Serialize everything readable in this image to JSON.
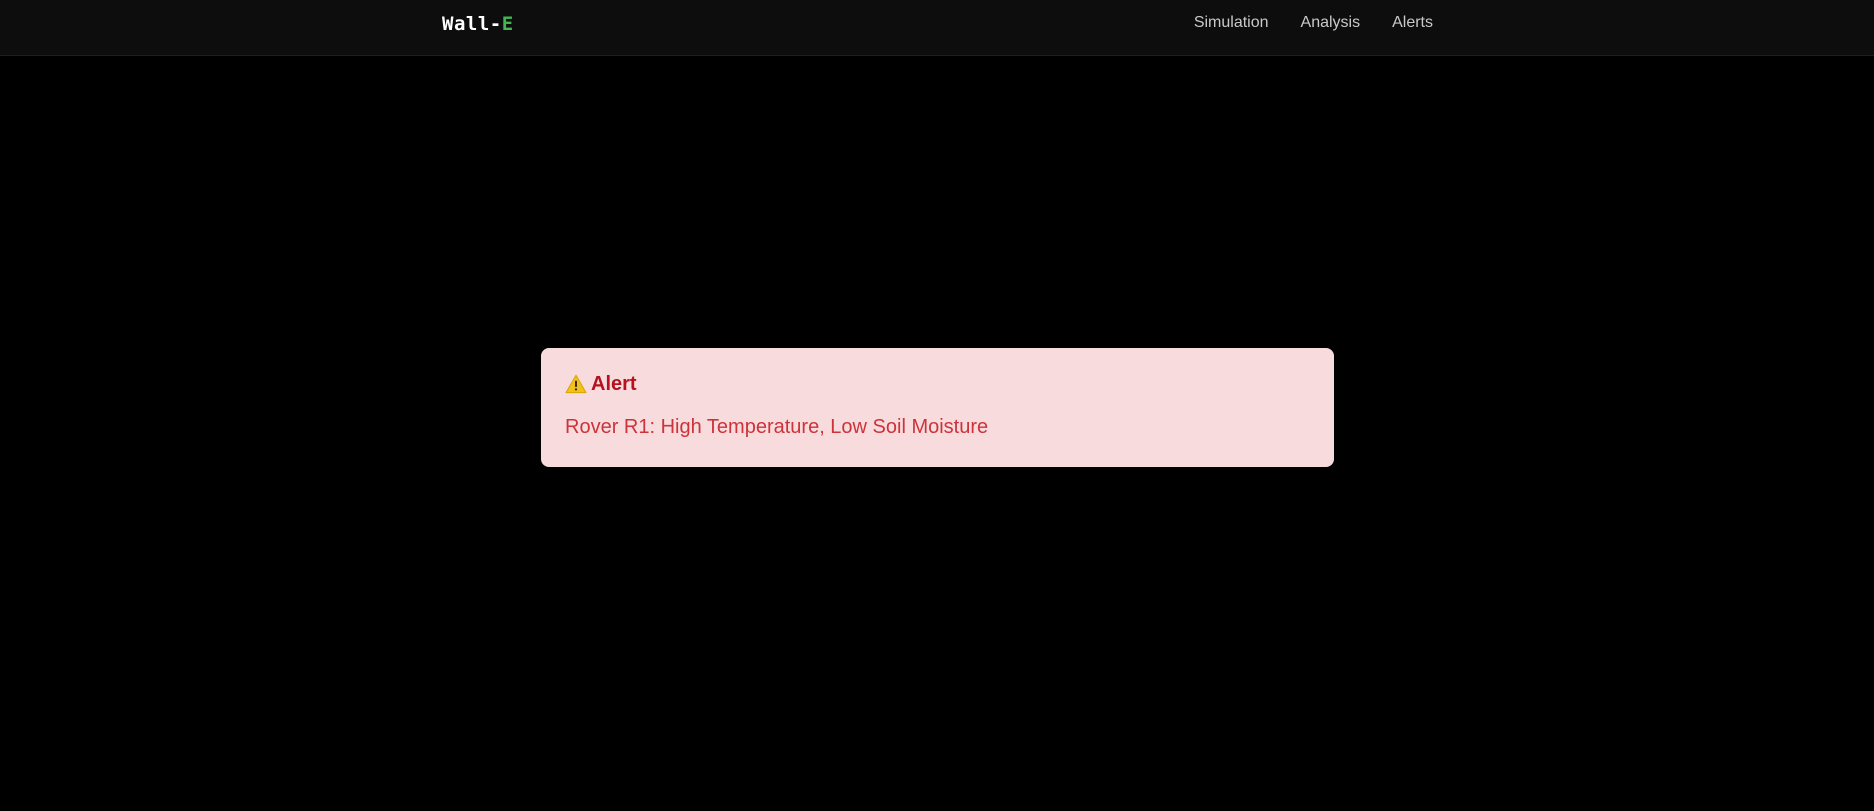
{
  "navbar": {
    "brand_prefix": "Wall-",
    "brand_suffix": "E",
    "links": [
      {
        "label": "Simulation"
      },
      {
        "label": "Analysis"
      },
      {
        "label": "Alerts"
      }
    ]
  },
  "alert": {
    "icon": "warning-icon",
    "title": "Alert",
    "message": "Rover R1: High Temperature, Low Soil Moisture"
  },
  "colors": {
    "background": "#000000",
    "navbar": "#0d0d0d",
    "brand_accent": "#3fb950",
    "alert_background": "#f8dcdd",
    "alert_title": "#b4121f",
    "alert_text": "#cc333b",
    "warning_icon": "#f2c11d"
  }
}
